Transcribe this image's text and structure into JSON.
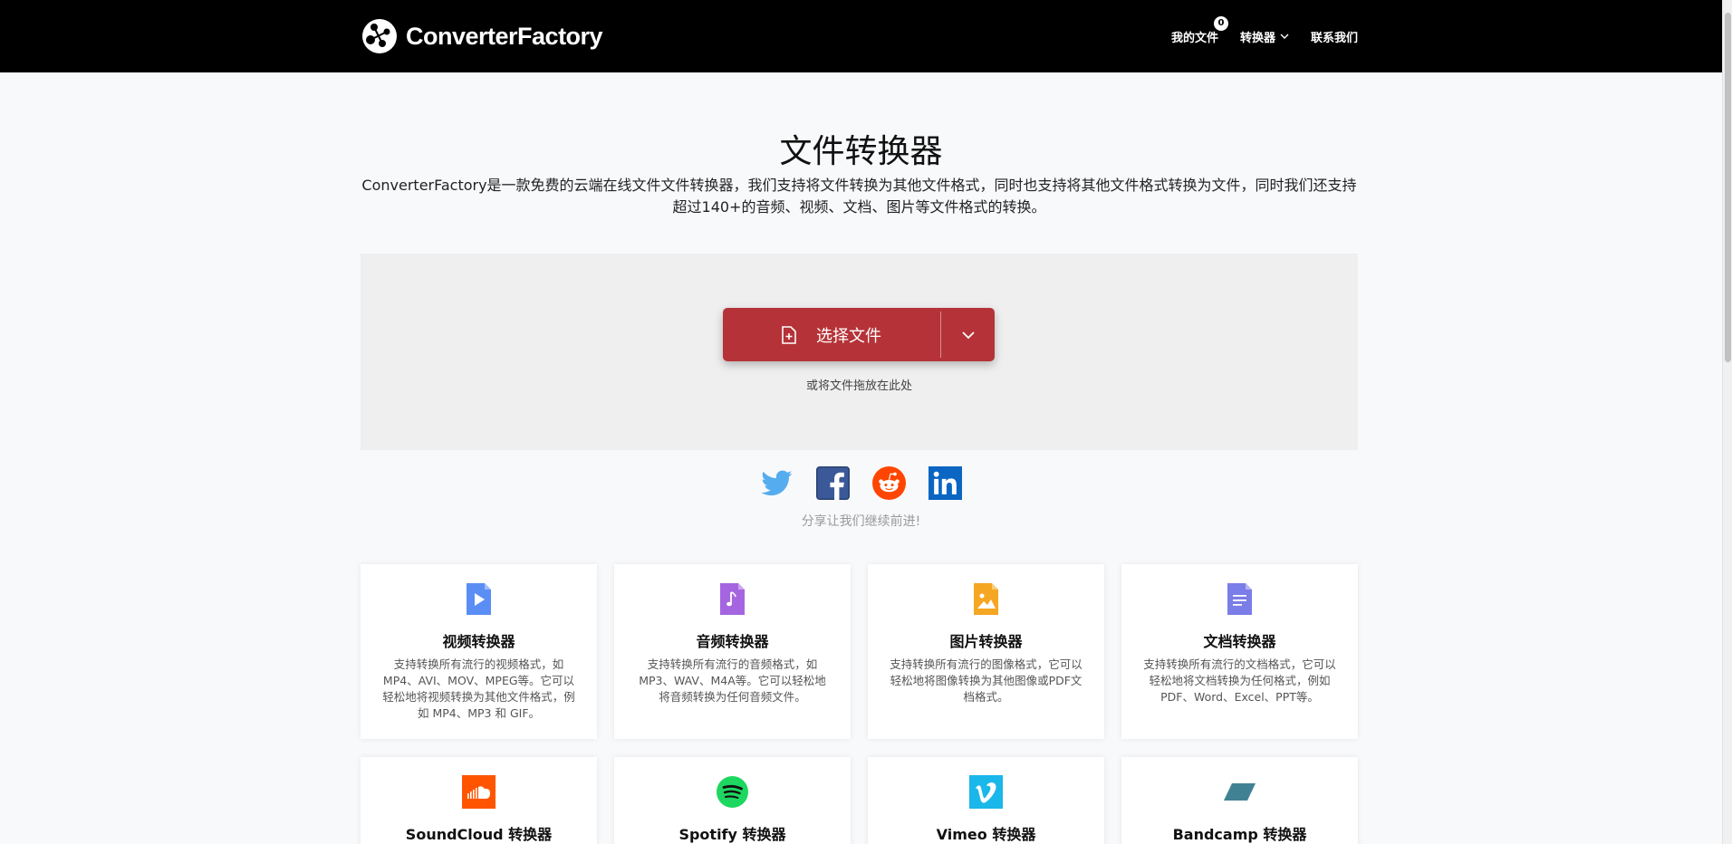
{
  "header": {
    "logo_text": "ConverterFactory",
    "nav": {
      "my_files": "我的文件",
      "my_files_count": "0",
      "converters": "转换器",
      "contact": "联系我们"
    }
  },
  "hero": {
    "title": "文件转换器",
    "description": "ConverterFactory是一款免费的云端在线文件文件转换器，我们支持将文件转换为其他文件格式，同时也支持将其他文件格式转换为文件，同时我们还支持超过140+的音频、视频、文档、图片等文件格式的转换。"
  },
  "upload": {
    "button_label": "选择文件",
    "drop_hint": "或将文件拖放在此处"
  },
  "share": {
    "text": "分享让我们继续前进!",
    "icons": [
      "twitter-icon",
      "facebook-icon",
      "reddit-icon",
      "linkedin-icon"
    ]
  },
  "cards": [
    {
      "title": "视频转换器",
      "desc": "支持转换所有流行的视频格式，如MP4、AVI、MOV、MPEG等。它可以轻松地将视频转换为其他文件格式，例如 MP4、MP3 和 GIF。",
      "icon": "video-file-icon",
      "color": "#5b8ef5"
    },
    {
      "title": "音频转换器",
      "desc": "支持转换所有流行的音频格式，如MP3、WAV、M4A等。它可以轻松地将音频转换为任何音频文件。",
      "icon": "audio-file-icon",
      "color": "#a565e0"
    },
    {
      "title": "图片转换器",
      "desc": "支持转换所有流行的图像格式，它可以轻松地将图像转换为其他图像或PDF文档格式。",
      "icon": "image-file-icon",
      "color": "#f5a623"
    },
    {
      "title": "文档转换器",
      "desc": "支持转换所有流行的文档格式，它可以轻松地将文档转换为任何格式，例如PDF、Word、Excel、PPT等。",
      "icon": "document-file-icon",
      "color": "#7b7de8"
    },
    {
      "title": "SoundCloud 转换器",
      "icon": "soundcloud-icon",
      "color": "#ff5500"
    },
    {
      "title": "Spotify 转换器",
      "icon": "spotify-icon",
      "color": "#1ed760"
    },
    {
      "title": "Vimeo 转换器",
      "icon": "vimeo-icon",
      "color": "#1ab7ea"
    },
    {
      "title": "Bandcamp 转换器",
      "icon": "bandcamp-icon",
      "color": "#408294"
    }
  ]
}
